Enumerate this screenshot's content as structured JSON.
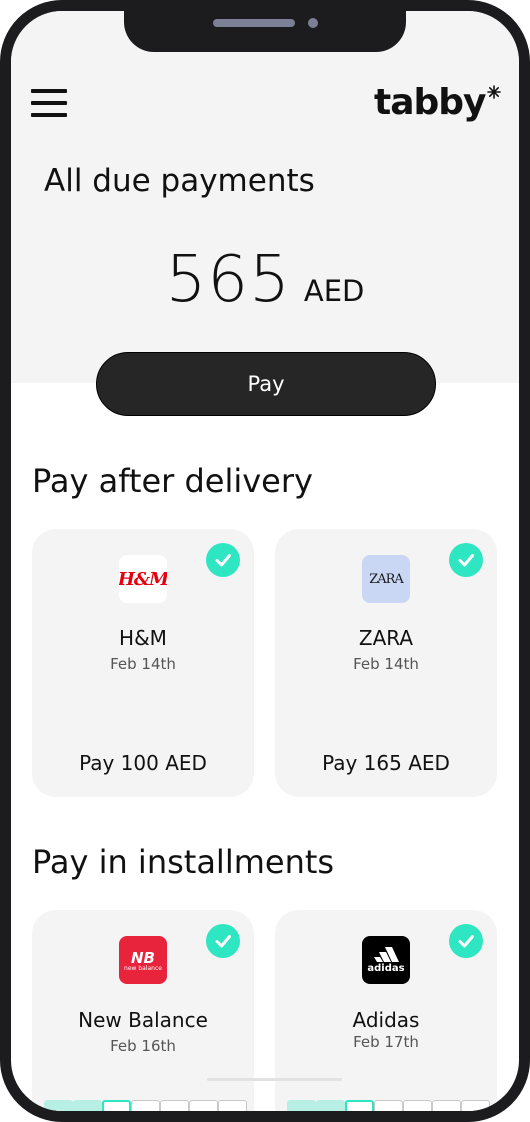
{
  "header": {
    "logo_text": "tabby",
    "page_title": "All due payments"
  },
  "summary": {
    "amount": "565",
    "currency": "AED",
    "pay_button_label": "Pay"
  },
  "sections": {
    "after_delivery_title": "Pay after delivery",
    "installments_title": "Pay in installments"
  },
  "after_delivery": [
    {
      "brand": "H&M",
      "logo_text": "H&M",
      "date": "Feb 14th",
      "pay_label": "Pay 100 AED",
      "paid_check": true
    },
    {
      "brand": "ZARA",
      "logo_text": "ZARA",
      "date": "Feb 14th",
      "pay_label": "Pay 165 AED",
      "paid_check": true
    }
  ],
  "installments": [
    {
      "brand": "New Balance",
      "logo_text": "new balance",
      "date": "Feb 16th",
      "paid_check": true,
      "installments_done": 2,
      "installments_total": 7
    },
    {
      "brand": "Adidas",
      "logo_text": "adidas",
      "date": "Feb 17th",
      "paid_check": true,
      "installments_done": 2,
      "installments_total": 7
    }
  ],
  "colors": {
    "accent": "#2ee6c1",
    "hm_red": "#e50010",
    "zara_bg": "#c9d7f5",
    "newbalance_red": "#e8233c",
    "adidas_black": "#000000",
    "button_dark": "#262626"
  },
  "icons": {
    "menu": "hamburger-menu-icon",
    "check": "checkmark-icon",
    "logo_mark": "tabby-star-icon"
  }
}
